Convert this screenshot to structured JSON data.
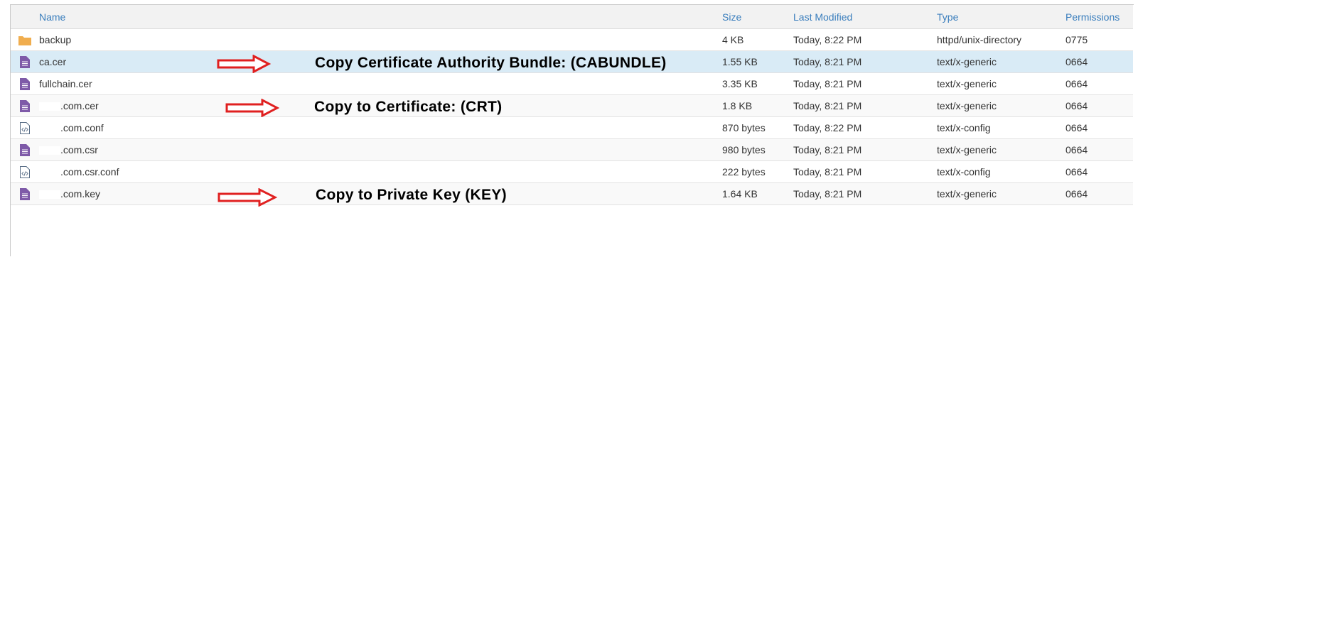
{
  "columns": {
    "name": "Name",
    "size": "Size",
    "modified": "Last Modified",
    "type": "Type",
    "permissions": "Permissions"
  },
  "rows": [
    {
      "icon": "folder-icon",
      "name": "backup",
      "size": "4 KB",
      "modified": "Today, 8:22 PM",
      "type": "httpd/unix-directory",
      "perm": "0775"
    },
    {
      "icon": "text-file-icon",
      "name": "ca.cer",
      "size": "1.55 KB",
      "modified": "Today, 8:21 PM",
      "type": "text/x-generic",
      "perm": "0664"
    },
    {
      "icon": "text-file-icon",
      "name": "fullchain.cer",
      "size": "3.35 KB",
      "modified": "Today, 8:21 PM",
      "type": "text/x-generic",
      "perm": "0664"
    },
    {
      "icon": "text-file-icon",
      "name": ".com.cer",
      "size": "1.8 KB",
      "modified": "Today, 8:21 PM",
      "type": "text/x-generic",
      "perm": "0664"
    },
    {
      "icon": "config-file-icon",
      "name": ".com.conf",
      "size": "870 bytes",
      "modified": "Today, 8:22 PM",
      "type": "text/x-config",
      "perm": "0664"
    },
    {
      "icon": "text-file-icon",
      "name": ".com.csr",
      "size": "980 bytes",
      "modified": "Today, 8:21 PM",
      "type": "text/x-generic",
      "perm": "0664"
    },
    {
      "icon": "config-file-icon",
      "name": ".com.csr.conf",
      "size": "222 bytes",
      "modified": "Today, 8:21 PM",
      "type": "text/x-config",
      "perm": "0664"
    },
    {
      "icon": "text-file-icon",
      "name": ".com.key",
      "size": "1.64 KB",
      "modified": "Today, 8:21 PM",
      "type": "text/x-generic",
      "perm": "0664"
    }
  ],
  "annotations": {
    "cabundle": "Copy Certificate Authority Bundle: (CABUNDLE)",
    "crt": "Copy to Certificate: (CRT)",
    "key": "Copy to Private Key (KEY)"
  },
  "colors": {
    "header_text": "#3a7ebd",
    "selected_row": "#d9ebf6",
    "folder": "#f0ad4e",
    "file": "#7e5aa8",
    "arrow": "#e02020"
  }
}
